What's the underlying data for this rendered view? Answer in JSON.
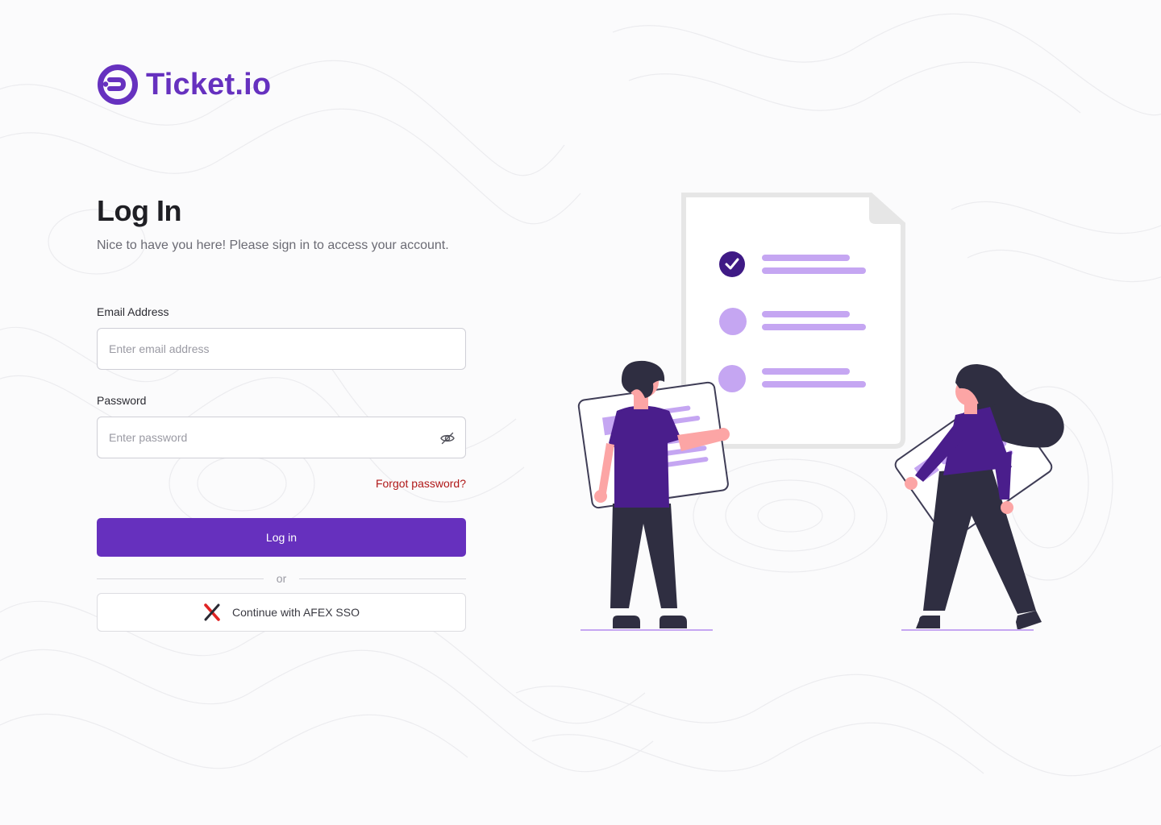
{
  "brand": {
    "name": "Ticket.io",
    "color": "#6631bf"
  },
  "login": {
    "title": "Log In",
    "subtitle": "Nice to have you here! Please sign in to access your account.",
    "email": {
      "label": "Email Address",
      "placeholder": "Enter email address",
      "value": ""
    },
    "password": {
      "label": "Password",
      "placeholder": "Enter password",
      "value": ""
    },
    "forgot_label": "Forgot password?",
    "submit_label": "Log in",
    "divider_label": "or",
    "sso_label": "Continue with AFEX SSO"
  },
  "icons": {
    "brand_logo": "ticket-logo-icon",
    "password_toggle": "eye-slash-icon",
    "sso": "afex-x-icon"
  },
  "colors": {
    "primary": "#6630be",
    "link_danger": "#b01818",
    "illustration_accent": "#c5a6f2",
    "illustration_dark": "#2f2e41"
  }
}
